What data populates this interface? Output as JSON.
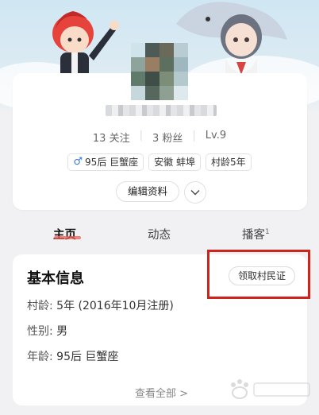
{
  "profile": {
    "stats": {
      "following": "13 关注",
      "followers": "3 粉丝",
      "level": "Lv.9"
    },
    "tags": [
      {
        "text": "95后 巨蟹座",
        "icon": "male-icon"
      },
      {
        "text": "安徽 蚌埠"
      },
      {
        "text": "村龄5年"
      }
    ],
    "edit_label": "编辑资料"
  },
  "tabs": [
    {
      "label": "主页",
      "active": true
    },
    {
      "label": "动态"
    },
    {
      "label": "播客",
      "badge": "1"
    }
  ],
  "info": {
    "title": "基本信息",
    "claim_label": "领取村民证",
    "rows": [
      {
        "key": "村龄:",
        "value": "5年 (2016年10月注册)"
      },
      {
        "key": "性别:",
        "value": "男"
      },
      {
        "key": "年龄:",
        "value": "95后 巨蟹座"
      }
    ],
    "view_all": "查看全部 >"
  },
  "colors": {
    "accent": "#f15b4d",
    "highlight": "#d0231b",
    "male": "#3b7ad9"
  }
}
